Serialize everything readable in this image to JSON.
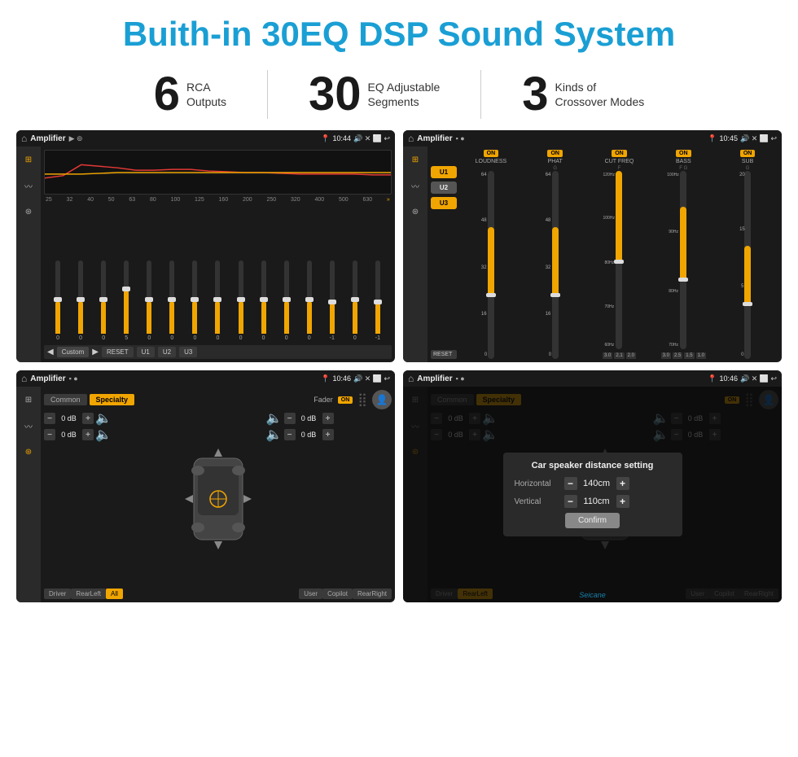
{
  "header": {
    "title": "Buith-in 30EQ DSP Sound System",
    "title_color": "#1a9fd4"
  },
  "stats": [
    {
      "number": "6",
      "label": "RCA\nOutputs"
    },
    {
      "number": "30",
      "label": "EQ Adjustable\nSegments"
    },
    {
      "number": "3",
      "label": "Kinds of\nCrossover Modes"
    }
  ],
  "screens": {
    "eq": {
      "title": "Amplifier",
      "time": "10:44",
      "freqs": [
        "25",
        "32",
        "40",
        "50",
        "63",
        "80",
        "100",
        "125",
        "160",
        "200",
        "250",
        "320",
        "400",
        "500",
        "630"
      ],
      "bottom_btns": [
        "Custom",
        "RESET",
        "U1",
        "U2",
        "U3"
      ]
    },
    "crossover": {
      "title": "Amplifier",
      "time": "10:45",
      "channels": [
        "U1",
        "U2",
        "U3"
      ],
      "toggles": [
        "LOUDNESS",
        "PHAT",
        "CUT FREQ",
        "BASS",
        "SUB"
      ],
      "reset_label": "RESET"
    },
    "fader": {
      "title": "Amplifier",
      "time": "10:46",
      "tabs": [
        "Common",
        "Specialty"
      ],
      "fader_label": "Fader",
      "position_btns": [
        "Driver",
        "RearLeft",
        "All",
        "User",
        "Copilot",
        "RearRight"
      ],
      "db_values": [
        "0 dB",
        "0 dB",
        "0 dB",
        "0 dB"
      ]
    },
    "dialog": {
      "title": "Amplifier",
      "time": "10:46",
      "tabs": [
        "Common",
        "Specialty"
      ],
      "dialog_title": "Car speaker distance setting",
      "horizontal_label": "Horizontal",
      "horizontal_value": "140cm",
      "vertical_label": "Vertical",
      "vertical_value": "110cm",
      "confirm_label": "Confirm",
      "position_btns": [
        "Driver",
        "RearLeft",
        "User",
        "Copilot",
        "RearRight"
      ],
      "watermark": "Seicane"
    }
  }
}
